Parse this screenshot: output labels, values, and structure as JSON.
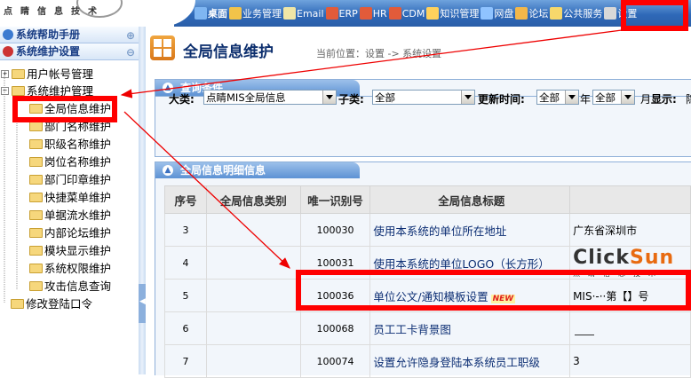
{
  "header": {
    "logo_text": "点睛信息技术",
    "nav": [
      {
        "label": "桌面",
        "icon": "desktop-icon",
        "color": "#7fb6f2"
      },
      {
        "label": "业务管理",
        "icon": "business-icon",
        "color": "#f2c34a"
      },
      {
        "label": "Email",
        "icon": "email-icon",
        "color": "#f0e6a6"
      },
      {
        "label": "ERP",
        "icon": "erp-icon",
        "color": "#e25b3a"
      },
      {
        "label": "HR",
        "icon": "hr-icon",
        "color": "#e25b3a"
      },
      {
        "label": "CDM",
        "icon": "cdm-icon",
        "color": "#e25b3a"
      },
      {
        "label": "知识管理",
        "icon": "knowledge-icon",
        "color": "#ffd15c"
      },
      {
        "label": "网盘",
        "icon": "netdisk-icon",
        "color": "#8fc3ff"
      },
      {
        "label": "论坛",
        "icon": "forum-icon",
        "color": "#f3b74a"
      },
      {
        "label": "公共服务",
        "icon": "public-service-icon",
        "color": "#f6d86b"
      },
      {
        "label": "设置",
        "icon": "settings-icon",
        "color": "#d8d8d8"
      }
    ]
  },
  "sidebar": {
    "sections": [
      {
        "label": "系统帮助手册",
        "icon": "help-icon"
      },
      {
        "label": "系统维护设置",
        "icon": "tools-icon"
      }
    ],
    "tree": {
      "user_accounts": "用户帐号管理",
      "system_maintenance": "系统维护管理",
      "children": [
        "全局信息维护",
        "部门名称维护",
        "职级名称维护",
        "岗位名称维护",
        "部门印章维护",
        "快捷菜单维护",
        "单据流水维护",
        "内部论坛维护",
        "模块显示维护",
        "系统权限维护",
        "攻击信息查询"
      ],
      "change_password": "修改登陆口令"
    }
  },
  "main": {
    "page_title": "全局信息维护",
    "breadcrumb": "当前位置：设置 -> 系统设置",
    "query_panel": {
      "title": "查询条件",
      "category_label": "大类:",
      "category_value": "点睛MIS全局信息",
      "subclass_label": "子类:",
      "subclass_value": "全部",
      "update_time_label": "更新时间:",
      "update_year_value": "全部",
      "year_label": "年",
      "update_month_value": "全部",
      "month_label": "月",
      "display_label": "显示:",
      "display_value": "隐"
    },
    "detail_panel": {
      "title": "全局信息明细信息",
      "columns": [
        "序号",
        "全局信息类别",
        "唯一识别号",
        "全局信息标题",
        ""
      ],
      "rows": [
        {
          "seq": "3",
          "category": "",
          "id": "100030",
          "title": "使用本系统的单位所在地址",
          "value": "广东省深圳市",
          "new": ""
        },
        {
          "seq": "4",
          "category": "",
          "id": "100031",
          "title": "使用本系统的单位LOGO（长方形）",
          "value": "",
          "new": ""
        },
        {
          "seq": "5",
          "category": "",
          "id": "100036",
          "title": "单位公文/通知模板设置",
          "value": "MIS·-··第【】号",
          "new": "NEW"
        },
        {
          "seq": "6",
          "category": "",
          "id": "100068",
          "title": "员工工卡背景图",
          "value": "",
          "new": ""
        },
        {
          "seq": "7",
          "category": "",
          "id": "100074",
          "title": "设置允许隐身登陆本系统员工职级",
          "value": "3",
          "new": ""
        }
      ],
      "logo_brand": "ClickSun",
      "logo_brand_part1": "Click",
      "logo_brand_part2": "Sun",
      "logo_sub": "点睛信息技术"
    }
  },
  "annotations": {
    "highlight_color": "#ff0000"
  }
}
